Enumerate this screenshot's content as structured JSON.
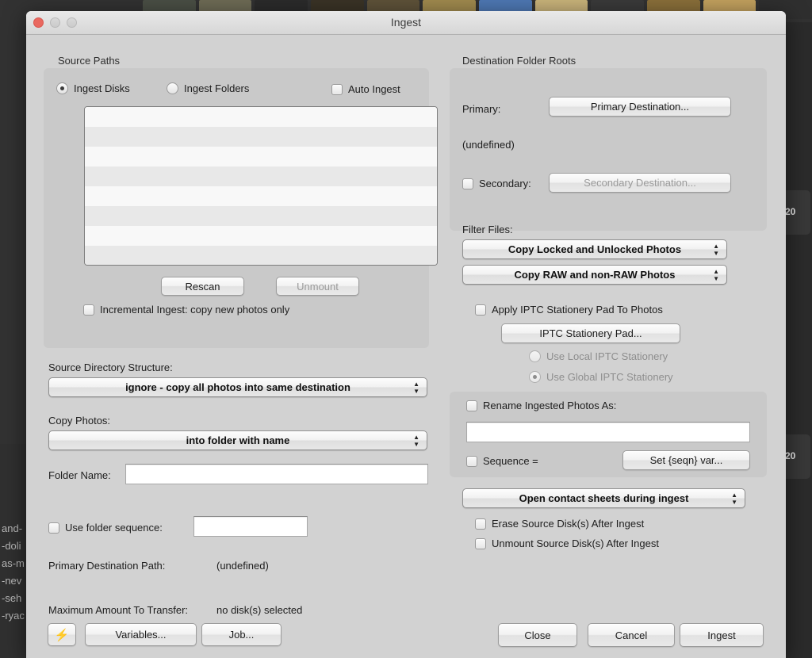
{
  "window": {
    "title": "Ingest",
    "traffic_lights": [
      "close-button",
      "minimize-button",
      "zoom-button"
    ]
  },
  "left": {
    "source_paths": {
      "group_label": "Source Paths",
      "radio_ingest_disks": "Ingest Disks",
      "radio_ingest_folders": "Ingest Folders",
      "checkbox_auto_ingest": "Auto Ingest",
      "selected_radio": "Ingest Disks",
      "list_items": [],
      "list_row_count": 8,
      "rescan_button": "Rescan",
      "unmount_button": "Unmount",
      "unmount_enabled": false,
      "incremental_ingest": "Incremental Ingest: copy new photos only",
      "incremental_checked": false,
      "auto_ingest_checked": false
    },
    "source_directory_structure": {
      "label": "Source Directory Structure:",
      "value": "ignore - copy all photos into same destination"
    },
    "copy_photos": {
      "label": "Copy Photos:",
      "value": "into folder with name"
    },
    "folder_name": {
      "label": "Folder Name:",
      "value": "",
      "placeholder": ""
    },
    "use_folder_sequence": {
      "label": "Use folder sequence:",
      "checked": false,
      "value": ""
    },
    "primary_destination_path": {
      "label": "Primary Destination Path:",
      "value": "(undefined)"
    },
    "maximum_amount_to_transfer": {
      "label": "Maximum Amount To Transfer:",
      "value": "no disk(s) selected"
    },
    "bolt_button": "⚡",
    "variables_button": "Variables...",
    "job_button": "Job..."
  },
  "right": {
    "destination_folder_roots": {
      "group_label": "Destination Folder Roots",
      "primary_label": "Primary:",
      "primary_button": "Primary Destination...",
      "primary_value": "(undefined)",
      "secondary_label": "Secondary:",
      "secondary_button": "Secondary Destination...",
      "secondary_checked": false,
      "secondary_enabled": false
    },
    "filter_files": {
      "label": "Filter Files:",
      "lock_filter": "Copy Locked and Unlocked Photos",
      "raw_filter": "Copy RAW and non-RAW Photos",
      "apply_iptc": "Apply IPTC Stationery Pad To Photos",
      "apply_iptc_checked": false,
      "iptc_pad_button": "IPTC Stationery Pad...",
      "radio_local": "Use Local IPTC Stationery",
      "radio_global": "Use Global IPTC Stationery",
      "selected_iptc_radio": "Use Global IPTC Stationery",
      "iptc_radios_enabled": false
    },
    "rename": {
      "checkbox_label": "Rename Ingested Photos As:",
      "checked": false,
      "pattern_value": "",
      "sequence_label": "Sequence =",
      "sequence_checked": false,
      "set_seqn_button": "Set {seqn} var..."
    },
    "contact_sheets": {
      "value": "Open contact sheets during ingest"
    },
    "erase_source": {
      "label": "Erase Source Disk(s) After Ingest",
      "checked": false
    },
    "unmount_source": {
      "label": "Unmount Source Disk(s) After Ingest",
      "checked": false
    },
    "actions": {
      "close_button": "Close",
      "cancel_button": "Cancel",
      "ingest_button": "Ingest"
    }
  },
  "backdrop": {
    "left_text_lines": [
      "and-",
      "-doli",
      "as-m",
      "-nev",
      "-seh",
      "-ryac"
    ],
    "right_card_labels": [
      "20",
      "20"
    ],
    "thumb_colors": [
      "#4a4f45",
      "#6e6b55",
      "#2b2b2b",
      "#3a3326",
      "#5e5239",
      "#a08a4e",
      "#4e78b4",
      "#c9b37a",
      "#3a3a3a",
      "#8a6f3a",
      "#c2a15e",
      "#2f2f2f"
    ]
  },
  "colors": {
    "window_bg": "#d2d2d2",
    "group_bg": "#c9c9c9",
    "accent_close": "#e9685f",
    "text": "#1d1d1d",
    "disabled_text": "#8e8e8e"
  }
}
